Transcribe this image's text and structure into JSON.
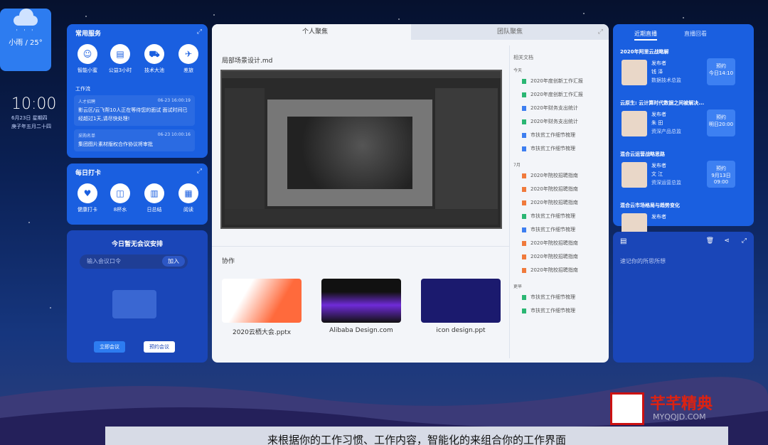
{
  "weather": {
    "text": "小雨 / 25°"
  },
  "clock": {
    "time": "10:00",
    "date": "6月23日 星期四",
    "lunar": "庚子年五月二十四"
  },
  "common": {
    "title": "常用服务",
    "items": [
      {
        "label": "智能小蜜"
      },
      {
        "label": "公益3小时"
      },
      {
        "label": "技术大池"
      },
      {
        "label": "差旅"
      }
    ],
    "flow_title": "工作流",
    "flows": [
      {
        "tag": "人才招聘",
        "time": "06-23 16:00:19",
        "text": "影云区/云飞帮10人正在等待您的面试 面试时间已经超过1天,请尽快处理!"
      },
      {
        "tag": "采购名单",
        "time": "06-23 10:00:16",
        "text": "集团图片素材版权合作协议将审批"
      }
    ]
  },
  "checkin": {
    "title": "每日打卡",
    "items": [
      {
        "label": "健康打卡"
      },
      {
        "label": "8杯水"
      },
      {
        "label": "日总结"
      },
      {
        "label": "阅读"
      }
    ]
  },
  "meeting": {
    "title": "今日暂无会议安排",
    "placeholder": "输入会议口令",
    "join": "加入",
    "start": "立即会议",
    "book": "预约会议"
  },
  "panel": {
    "tab1": "个人聚焦",
    "tab2": "团队聚焦",
    "filename": "局部场景设计.md",
    "collab": "协作",
    "thumbs": [
      {
        "caption": "2020云栖大会.pptx"
      },
      {
        "caption": "Alibaba Design.com"
      },
      {
        "caption": "icon design.ppt"
      }
    ],
    "docs_title": "相关文档",
    "groups": [
      {
        "name": "今天",
        "items": [
          "2020年度创新工作汇报",
          "2020年度创新工作汇报",
          "2020年财务支出统计",
          "2020年财务支出统计",
          "市扶贫工作细节梳理",
          "市扶贫工作细节梳理"
        ]
      },
      {
        "name": "7月",
        "items": [
          "2020年院校招聘指南",
          "2020年院校招聘指南",
          "2020年院校招聘指南",
          "市扶贫工作细节梳理",
          "市扶贫工作细节梳理",
          "2020年院校招聘指南",
          "2020年院校招聘指南",
          "2020年院校招聘指南"
        ]
      },
      {
        "name": "更早",
        "items": [
          "市扶贫工作细节梳理",
          "市扶贫工作细节梳理"
        ]
      }
    ]
  },
  "live": {
    "tab1": "近期直播",
    "tab2": "直播回看",
    "items": [
      {
        "title": "2020年阿里云战略解",
        "pub": "发布者",
        "name": "钱  泽",
        "role": "数据技术总监",
        "btn": "预约",
        "time": "今日14:10"
      },
      {
        "title": "云原生: 云计算时代数据之间被解决...",
        "pub": "发布者",
        "name": "朱  田",
        "role": "资深产品总监",
        "btn": "预约",
        "time": "明日20:00"
      },
      {
        "title": "混合云运营战略思路",
        "pub": "发布者",
        "name": "文  江",
        "role": "资深运营总监",
        "btn": "预约",
        "time": "9月13日 09:00"
      },
      {
        "title": "混合云市场格局与趋势变化",
        "pub": "发布者",
        "name": "",
        "role": "",
        "btn": "",
        "time": ""
      }
    ]
  },
  "note": {
    "placeholder": "速记你的所思所想"
  },
  "subtitle": "来根据你的工作习惯、工作内容，智能化的来组合你的工作界面",
  "watermark": {
    "main": "芊芊精典",
    "url": "MYQQJD.COM"
  }
}
